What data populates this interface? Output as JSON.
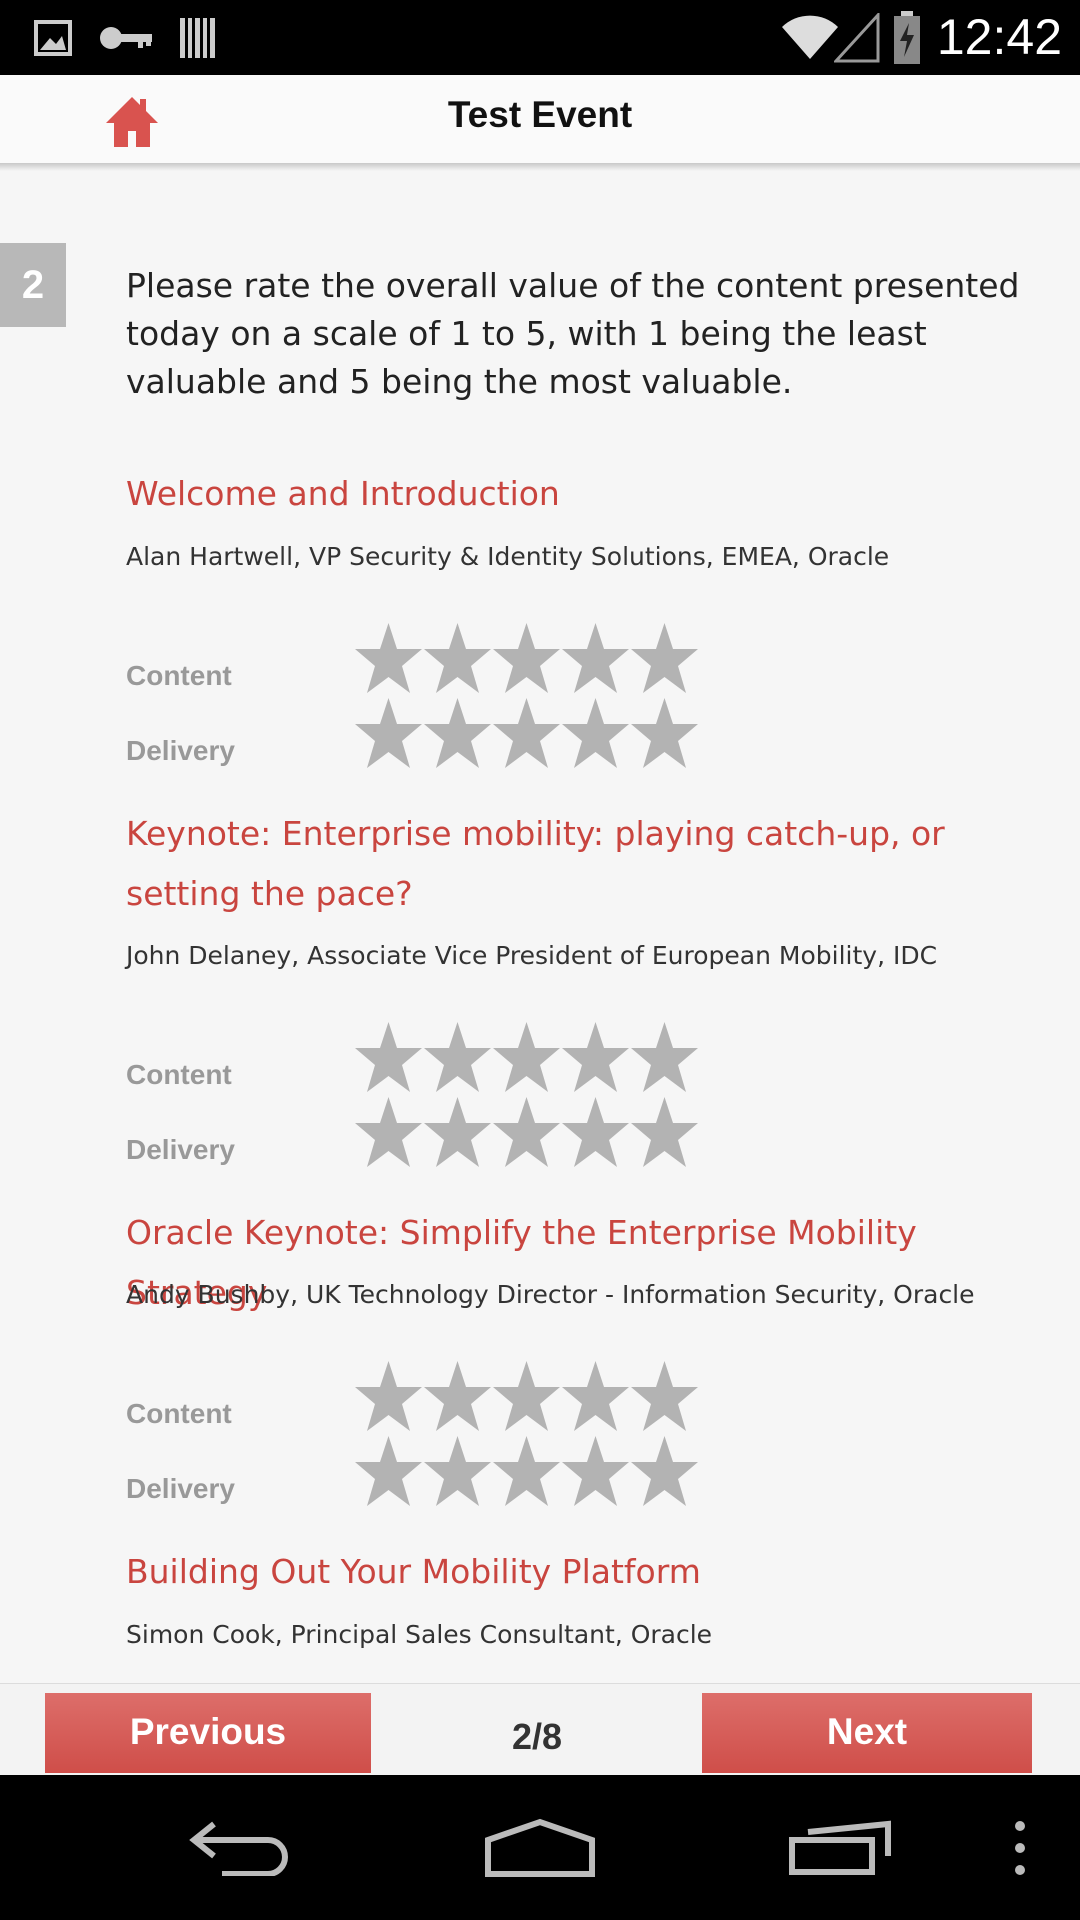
{
  "status_bar": {
    "time": "12:42",
    "icons": [
      "gallery-icon",
      "key-icon",
      "barcode-icon",
      "wifi-icon",
      "signal-icon",
      "battery-charging-icon"
    ]
  },
  "app_bar": {
    "title": "Test Event",
    "home_icon": "home-icon"
  },
  "question": {
    "number": "2",
    "text": "Please rate the overall value of the content presented today on a scale of 1 to 5, with 1 being the least valuable and 5 being the most valuable."
  },
  "labels": {
    "content": "Content",
    "delivery": "Delivery"
  },
  "sessions": [
    {
      "title": "Welcome and Introduction",
      "speaker": "Alan Hartwell, VP Security & Identity Solutions, EMEA, Oracle",
      "content_rating": 0,
      "delivery_rating": 0
    },
    {
      "title": "Keynote: Enterprise mobility: playing catch-up, or setting the pace?",
      "speaker": "John Delaney, Associate Vice President of European Mobility, IDC",
      "content_rating": 0,
      "delivery_rating": 0
    },
    {
      "title": "Oracle Keynote: Simplify the Enterprise Mobility Strategy",
      "speaker": "Andy Bushby, UK Technology Director - Information Security, Oracle",
      "content_rating": 0,
      "delivery_rating": 0
    },
    {
      "title": "Building Out Your Mobility Platform",
      "speaker": "Simon Cook, Principal Sales Consultant, Oracle"
    }
  ],
  "pager": {
    "previous_label": "Previous",
    "next_label": "Next",
    "page_indicator": "2/8"
  },
  "colors": {
    "accent": "#c9453f",
    "button": "#d65a55",
    "star_empty": "#b3b3b3"
  },
  "nav_bar": {
    "icons": [
      "back-icon",
      "home-nav-icon",
      "recent-apps-icon",
      "overflow-menu-icon"
    ]
  }
}
